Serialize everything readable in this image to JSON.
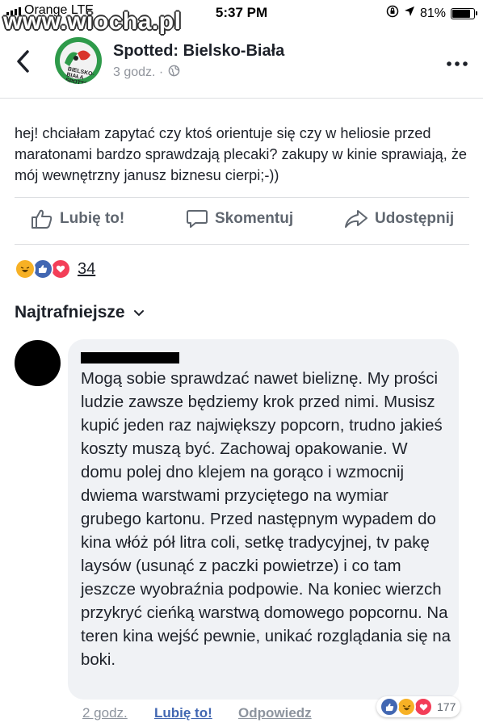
{
  "status_bar": {
    "carrier": "Orange LTE",
    "time": "5:37 PM",
    "battery": "81%",
    "watermark": "www.wiocha.pl"
  },
  "header": {
    "page_name": "Spotted: Bielsko-Biała",
    "post_time": "3 godz. ·",
    "logo_text": "BIELSKO-BIAŁA SPOTTED"
  },
  "post": {
    "text": "hej! chciałam zapytać czy ktoś orientuje się czy w heliosie przed maratonami bardzo sprawdzają plecaki? zakupy w kinie sprawiają, że mój wewnętrzny janusz biznesu cierpi;-))",
    "like_label": "Lubię to!",
    "comment_label": "Skomentuj",
    "share_label": "Udostępnij",
    "reaction_count": "34"
  },
  "comments": {
    "sort_label": "Najtrafniejsze",
    "items": [
      {
        "text": "Mogą sobie sprawdzać nawet bieliznę. My prości ludzie zawsze będziemy krok przed nimi. Musisz kupić jeden raz największy popcorn, trudno jakieś koszty muszą być. Zachowaj opakowanie. W domu polej dno klejem na gorąco i wzmocnij dwiema warstwami przyciętego na wymiar grubego kartonu. Przed następnym wypadem do kina włóż pół litra coli, setkę tradycyjnej, tv pakę laysów (usunąć z paczki powietrze) i co tam jeszcze wyobraźnia podpowie. Na koniec wierzch przykryć cieńką warstwą domowego popcornu. Na teren kina wejść pewnie, unikać rozglądania się na boki.",
        "time": "2 godz.",
        "like_label": "Lubię to!",
        "reply_label": "Odpowiedz",
        "reaction_count": "177"
      }
    ]
  },
  "colors": {
    "like_blue": "#4267b2",
    "love_red": "#f33e58",
    "haha_yellow": "#f7b125",
    "text_gray": "#606770"
  }
}
